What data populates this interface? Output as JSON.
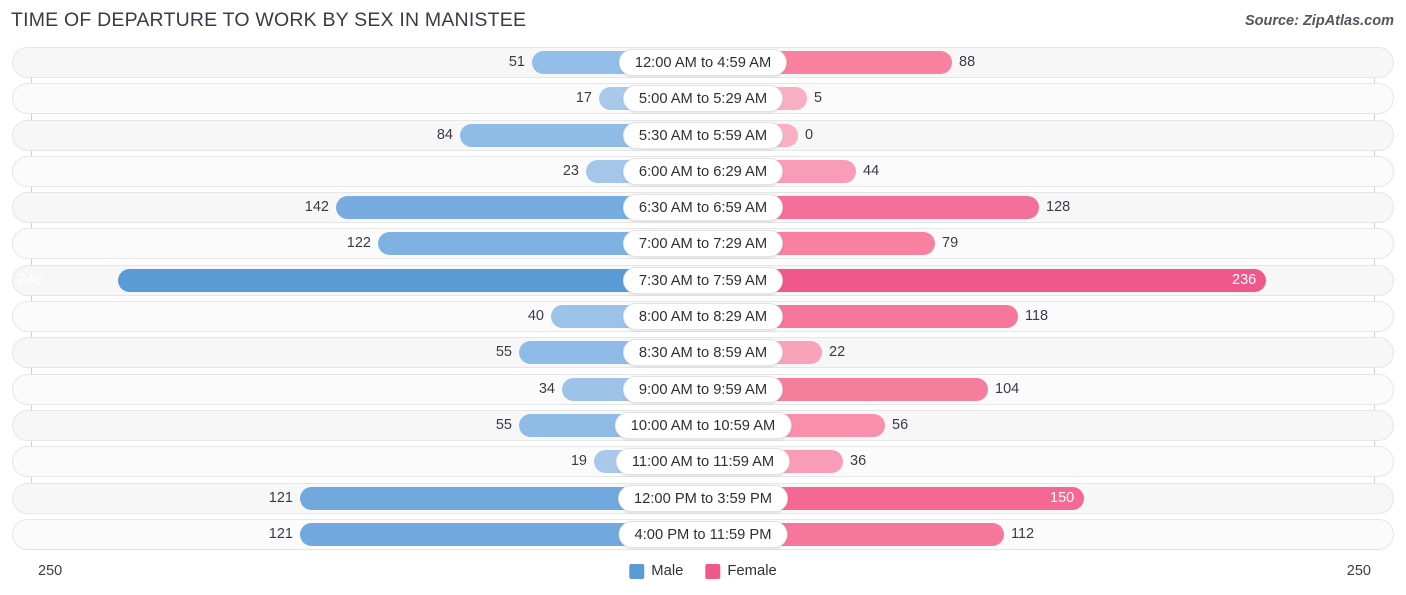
{
  "header": {
    "title": "TIME OF DEPARTURE TO WORK BY SEX IN MANISTEE",
    "source": "Source: ZipAtlas.com"
  },
  "legend": {
    "male_label": "Male",
    "female_label": "Female",
    "male_color": "#5B9BD5",
    "female_color": "#F0588B"
  },
  "axis": {
    "left_tick": "250",
    "right_tick": "250"
  },
  "chart_data": {
    "type": "bar",
    "title": "TIME OF DEPARTURE TO WORK BY SEX IN MANISTEE",
    "subtitle": "",
    "orientation": "horizontal-diverging",
    "xlabel": "",
    "ylabel": "",
    "xlim": [
      250,
      250
    ],
    "grid": false,
    "legend_position": "bottom-center",
    "categories": [
      "12:00 AM to 4:59 AM",
      "5:00 AM to 5:29 AM",
      "5:30 AM to 5:59 AM",
      "6:00 AM to 6:29 AM",
      "6:30 AM to 6:59 AM",
      "7:00 AM to 7:29 AM",
      "7:30 AM to 7:59 AM",
      "8:00 AM to 8:29 AM",
      "8:30 AM to 8:59 AM",
      "9:00 AM to 9:59 AM",
      "10:00 AM to 10:59 AM",
      "11:00 AM to 11:59 AM",
      "12:00 PM to 3:59 PM",
      "4:00 PM to 11:59 PM"
    ],
    "series": [
      {
        "name": "Male",
        "values": [
          51,
          17,
          84,
          23,
          142,
          122,
          246,
          40,
          55,
          34,
          55,
          19,
          121,
          121
        ]
      },
      {
        "name": "Female",
        "values": [
          88,
          5,
          0,
          44,
          128,
          79,
          236,
          118,
          22,
          104,
          56,
          36,
          150,
          112
        ]
      }
    ]
  },
  "rows": [
    {
      "category": "12:00 AM to 4:59 AM",
      "male": "51",
      "female": "88",
      "male_w": 171,
      "female_w": 249,
      "male_c": "#92BEE8",
      "female_c": "#F7819F",
      "male_in": false,
      "female_in": false
    },
    {
      "category": "5:00 AM to 5:29 AM",
      "male": "17",
      "female": "5",
      "male_w": 104,
      "female_w": 104,
      "male_c": "#A8C8EC",
      "female_c": "#FAAEC4",
      "male_in": false,
      "female_in": false
    },
    {
      "category": "5:30 AM to 5:59 AM",
      "male": "84",
      "female": "0",
      "male_w": 243,
      "female_w": 95,
      "male_c": "#8FBCE7",
      "female_c": "#FAAEC4",
      "male_in": false,
      "female_in": false
    },
    {
      "category": "6:00 AM to 6:29 AM",
      "male": "23",
      "female": "44",
      "male_w": 117,
      "female_w": 153,
      "male_c": "#A5C6EB",
      "female_c": "#F99CB7",
      "male_in": false,
      "female_in": false
    },
    {
      "category": "6:30 AM to 6:59 AM",
      "male": "142",
      "female": "128",
      "male_w": 367,
      "female_w": 336,
      "male_c": "#76ACE0",
      "female_c": "#F4709A",
      "male_in": false,
      "female_in": false
    },
    {
      "category": "7:00 AM to 7:29 AM",
      "male": "122",
      "female": "79",
      "male_w": 325,
      "female_w": 232,
      "male_c": "#7FB2E2",
      "female_c": "#F7819F",
      "male_in": false,
      "female_in": false
    },
    {
      "category": "7:30 AM to 7:59 AM",
      "male": "246",
      "female": "236",
      "male_w": 585,
      "female_w": 563,
      "male_c": "#5B9BD5",
      "female_c": "#F0588B",
      "male_in": true,
      "female_in": true
    },
    {
      "category": "8:00 AM to 8:29 AM",
      "male": "40",
      "female": "118",
      "male_w": 152,
      "female_w": 315,
      "male_c": "#9BC2E9",
      "female_c": "#F5779C",
      "male_in": false,
      "female_in": false
    },
    {
      "category": "8:30 AM to 8:59 AM",
      "male": "55",
      "female": "22",
      "male_w": 184,
      "female_w": 119,
      "male_c": "#8FBCE7",
      "female_c": "#F9A3BB",
      "male_in": false,
      "female_in": false
    },
    {
      "category": "9:00 AM to 9:59 AM",
      "male": "34",
      "female": "104",
      "male_w": 141,
      "female_w": 285,
      "male_c": "#9DC3E9",
      "female_c": "#F67E9D",
      "male_in": false,
      "female_in": false
    },
    {
      "category": "10:00 AM to 10:59 AM",
      "male": "55",
      "female": "56",
      "male_w": 184,
      "female_w": 182,
      "male_c": "#8FBCE7",
      "female_c": "#F88FAB",
      "male_in": false,
      "female_in": false
    },
    {
      "category": "11:00 AM to 11:59 AM",
      "male": "19",
      "female": "36",
      "male_w": 109,
      "female_w": 140,
      "male_c": "#A8C8EC",
      "female_c": "#F99CB7",
      "male_in": false,
      "female_in": false
    },
    {
      "category": "12:00 PM to 3:59 PM",
      "male": "121",
      "female": "150",
      "male_w": 403,
      "female_w": 381,
      "male_c": "#71A9DF",
      "female_c": "#F46894",
      "male_in": false,
      "female_in": true
    },
    {
      "category": "4:00 PM to 11:59 PM",
      "male": "121",
      "female": "112",
      "male_w": 403,
      "female_w": 301,
      "male_c": "#71A9DF",
      "female_c": "#F5779C",
      "male_in": false,
      "female_in": false
    }
  ]
}
